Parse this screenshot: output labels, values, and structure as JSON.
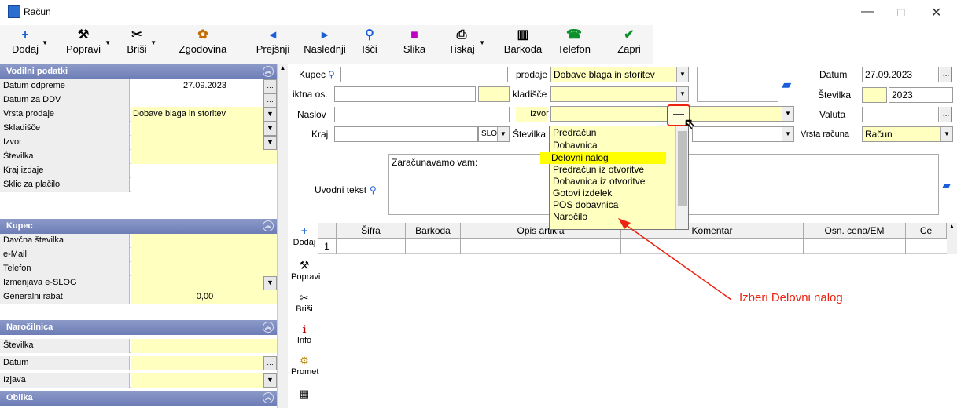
{
  "window": {
    "title": "Račun",
    "minimize": "—",
    "maximize": "☐",
    "close": "✕"
  },
  "toolbar": [
    {
      "label": "Dodaj",
      "icon": "+"
    },
    {
      "label": "Popravi",
      "icon": "⚒"
    },
    {
      "label": "Briši",
      "icon": "✂"
    },
    {
      "label": "Zgodovina",
      "icon": "✿"
    },
    {
      "label": "Prejšnji",
      "icon": "◂"
    },
    {
      "label": "Naslednji",
      "icon": "▸"
    },
    {
      "label": "Išči",
      "icon": "⚲"
    },
    {
      "label": "Slika",
      "icon": "■"
    },
    {
      "label": "Tiskaj",
      "icon": "⎙"
    },
    {
      "label": "Barkoda",
      "icon": "▥"
    },
    {
      "label": "Telefon",
      "icon": "☎"
    },
    {
      "label": "Zapri",
      "icon": "✔"
    }
  ],
  "left": {
    "sections": {
      "vodilni": "Vodilni podatki",
      "kupec": "Kupec",
      "narocilnica": "Naročilnica",
      "oblika": "Oblika"
    },
    "vodilni": [
      {
        "label": "Datum odpreme",
        "value": "27.09.2023"
      },
      {
        "label": "Datum za DDV",
        "value": ""
      },
      {
        "label": "Vrsta prodaje",
        "value": "Dobave blaga in storitev"
      },
      {
        "label": "Skladišče",
        "value": ""
      },
      {
        "label": "Izvor",
        "value": ""
      },
      {
        "label": "Številka",
        "value": ""
      },
      {
        "label": "Kraj izdaje",
        "value": ""
      },
      {
        "label": "Sklic za plačilo",
        "value": ""
      }
    ],
    "kupec": [
      {
        "label": "Davčna številka",
        "value": ""
      },
      {
        "label": "e-Mail",
        "value": ""
      },
      {
        "label": "Telefon",
        "value": ""
      },
      {
        "label": "Izmenjava e-SLOG",
        "value": ""
      },
      {
        "label": "Generalni rabat",
        "value": "0,00"
      }
    ],
    "narocilnica": [
      {
        "label": "Številka",
        "value": ""
      },
      {
        "label": "Datum",
        "value": ""
      },
      {
        "label": "Izjava",
        "value": ""
      }
    ]
  },
  "form": {
    "kupec": "Kupec",
    "davcna": "iktna os.",
    "naslov": "Naslov",
    "kraj": "Kraj",
    "kraj_code": "SLO",
    "vrsta_prodaje_lbl": "prodaje",
    "vrsta_prodaje_val": "Dobave blaga in storitev",
    "skladisce": "kladišče",
    "izvor": "Izvor",
    "stevilka_lbl": "Številka",
    "datum_lbl": "Datum",
    "datum_val": "27.09.2023",
    "st_lbl": "Številka",
    "st_val": "2023",
    "valuta_lbl": "Valuta",
    "vrsta_racuna_lbl": "Vrsta računa",
    "vrsta_racuna_val": "Račun",
    "uvodni_lbl": "Uvodni tekst",
    "uvodni_val": "Zaračunavamo vam:"
  },
  "dropdown": [
    "Predračun",
    "Dobavnica",
    "Delovni nalog",
    "Predračun iz otvoritve",
    "Dobavnica iz otvoritve",
    "Gotovi izdelek",
    "POS dobavnica",
    "Naročilo"
  ],
  "grid": {
    "cols": [
      "Šifra",
      "Barkoda",
      "Opis artikla",
      "Komentar",
      "Osn. cena/EM",
      "Ce"
    ],
    "row_no": "1"
  },
  "side": [
    {
      "label": "Dodaj",
      "icon": "+"
    },
    {
      "label": "Popravi",
      "icon": "⚒"
    },
    {
      "label": "Briši",
      "icon": "✂"
    },
    {
      "label": "Info",
      "icon": "ℹ"
    },
    {
      "label": "Promet",
      "icon": "⚙"
    },
    {
      "label": "",
      "icon": "▦"
    }
  ],
  "annotation": "Izberi Delovni nalog"
}
